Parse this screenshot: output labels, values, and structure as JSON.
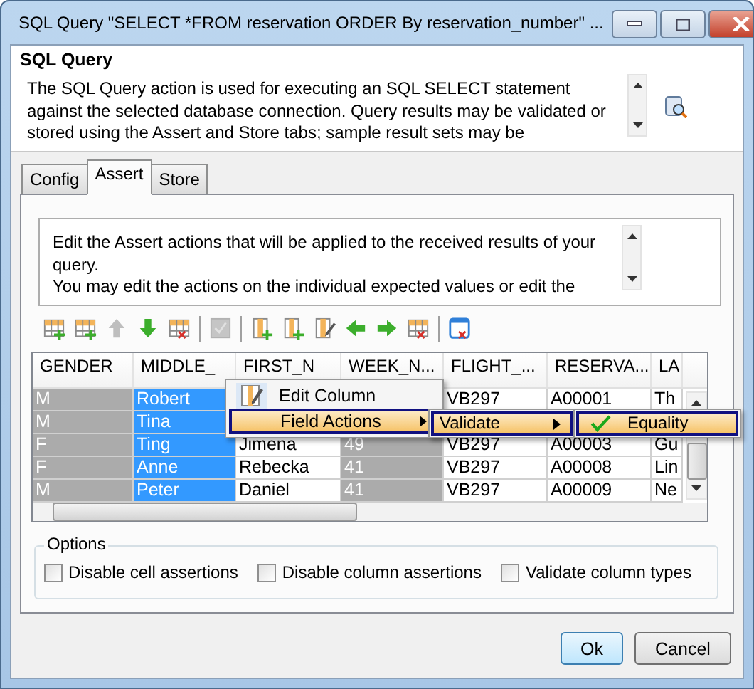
{
  "window": {
    "title": "SQL Query \"SELECT *FROM reservation  ORDER By reservation_number\" ..."
  },
  "header": {
    "title": "SQL Query",
    "description": "The SQL Query action is used for executing an SQL SELECT statement against the selected database connection. Query results may be validated or stored using the Assert and Store tabs; sample result sets may be"
  },
  "tabs": [
    {
      "label": "Config",
      "selected": false
    },
    {
      "label": "Assert",
      "selected": true
    },
    {
      "label": "Store",
      "selected": false
    }
  ],
  "assert_description": [
    "Edit the Assert actions that will be applied to the received results of your query.",
    "You may edit the actions on the individual expected values or edit the"
  ],
  "toolbar": [
    {
      "kind": "add-row",
      "disabled": false
    },
    {
      "kind": "add-row",
      "disabled": false
    },
    {
      "kind": "up",
      "disabled": true
    },
    {
      "kind": "down",
      "disabled": false
    },
    {
      "kind": "delete-grid",
      "disabled": false
    },
    {
      "kind": "separator"
    },
    {
      "kind": "check-grid",
      "disabled": true
    },
    {
      "kind": "separator"
    },
    {
      "kind": "add-column",
      "disabled": false
    },
    {
      "kind": "add-column",
      "disabled": false
    },
    {
      "kind": "edit-column",
      "disabled": false
    },
    {
      "kind": "left",
      "disabled": false
    },
    {
      "kind": "right",
      "disabled": false
    },
    {
      "kind": "delete-grid",
      "disabled": false
    },
    {
      "kind": "separator"
    },
    {
      "kind": "delete-window",
      "disabled": false
    }
  ],
  "table": {
    "columns": [
      {
        "label": "GENDER",
        "selected": false,
        "disabled": true
      },
      {
        "label": "MIDDLE_",
        "selected": true,
        "disabled": false
      },
      {
        "label": "FIRST_N",
        "selected": false,
        "disabled": false
      },
      {
        "label": "WEEK_N...",
        "selected": false,
        "disabled": true
      },
      {
        "label": "FLIGHT_...",
        "selected": false,
        "disabled": false
      },
      {
        "label": "RESERVA...",
        "selected": false,
        "disabled": false
      },
      {
        "label": "LA",
        "selected": false,
        "disabled": false
      }
    ],
    "rows": [
      {
        "cells": [
          "M",
          "Robert",
          null,
          null,
          "VB297",
          "A00001",
          "Th"
        ]
      },
      {
        "cells": [
          "M",
          "Tina",
          null,
          null,
          null,
          null,
          null
        ]
      },
      {
        "cells": [
          "F",
          "Ting",
          "Jimena",
          "49",
          "VB297",
          "A00003",
          "Gu"
        ]
      },
      {
        "cells": [
          "F",
          "Anne",
          "Rebecka",
          "41",
          "VB297",
          "A00008",
          "Lin"
        ]
      },
      {
        "cells": [
          "M",
          "Peter",
          "Daniel",
          "41",
          "VB297",
          "A00009",
          "Ne"
        ]
      }
    ]
  },
  "context_menu": {
    "items": [
      {
        "label": "Edit Column",
        "selected": false,
        "has_submenu": false
      },
      {
        "label": "Field Actions",
        "selected": true,
        "has_submenu": true
      }
    ]
  },
  "submenu": {
    "items": [
      {
        "label": "Validate",
        "selected": true,
        "has_submenu": true
      }
    ]
  },
  "submenu_2": {
    "items": [
      {
        "label": "Equality",
        "selected": true,
        "checked": true
      }
    ]
  },
  "options": {
    "title": "Options",
    "checkboxes": [
      {
        "label": "Disable cell assertions",
        "checked": false
      },
      {
        "label": "Disable column assertions",
        "checked": false
      },
      {
        "label": "Validate column types",
        "checked": false
      }
    ]
  },
  "buttons": [
    {
      "label": "Ok",
      "default": true
    },
    {
      "label": "Cancel",
      "default": false
    }
  ]
}
